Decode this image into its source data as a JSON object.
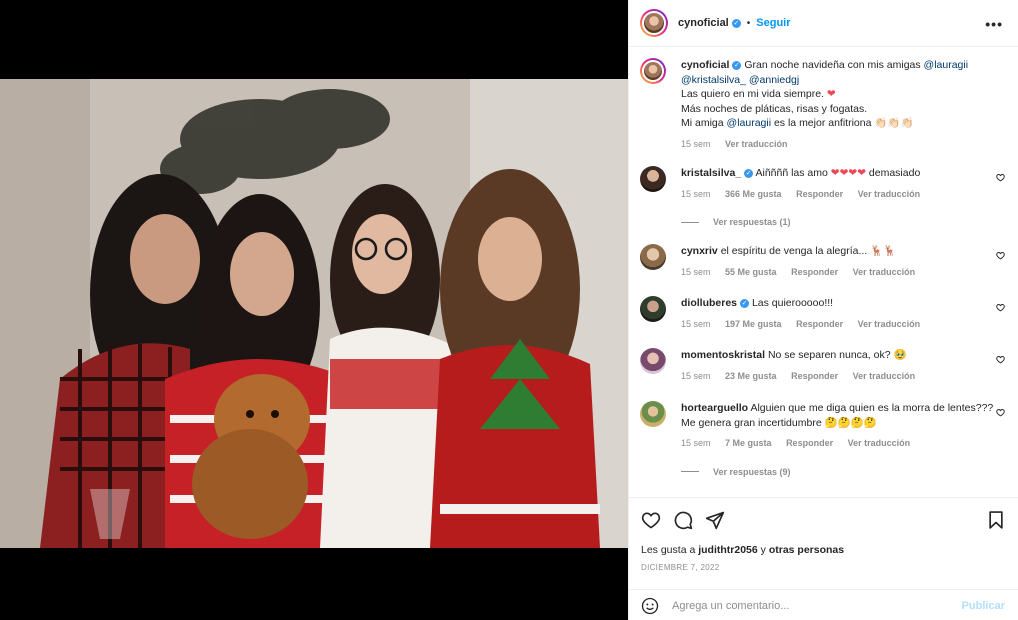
{
  "header": {
    "username": "cynoficial",
    "dot": "•",
    "follow_label": "Seguir",
    "more_label": "•••",
    "more_icon": "more-options-icon"
  },
  "caption": {
    "username": "cynoficial",
    "line1_text": "Gran noche navideña con mis amigas",
    "line1_mention": "@lauragii",
    "line2_mention_a": "@kristalsilva_",
    "line2_mention_b": "@anniedgj",
    "line3": "Las quiero en mi vida siempre.",
    "line3_emoji": "❤",
    "line4": "Más noches de pláticas, risas y fogatas.",
    "line5_prefix": "Mi amiga",
    "line5_mention": "@lauragii",
    "line5_suffix": "es la mejor anfitriona",
    "line5_emoji": "👏🏻👏🏻👏🏻",
    "time": "15 sem",
    "translate": "Ver traducción"
  },
  "comments": [
    {
      "username": "kristalsilva_",
      "verified": true,
      "text": "Aiññññ las amo",
      "emoji": "❤❤❤❤",
      "text_after": "demasiado",
      "time": "15 sem",
      "likes": "366 Me gusta",
      "reply": "Responder",
      "translate": "Ver traducción",
      "replies": "Ver respuestas (1)"
    },
    {
      "username": "cynxriv",
      "verified": false,
      "text": "el espíritu de venga la alegría... 🦌🦌",
      "time": "15 sem",
      "likes": "55 Me gusta",
      "reply": "Responder",
      "translate": "Ver traducción"
    },
    {
      "username": "diolluberes",
      "verified": true,
      "text": "Las quierooooo!!!",
      "time": "15 sem",
      "likes": "197 Me gusta",
      "reply": "Responder",
      "translate": "Ver traducción"
    },
    {
      "username": "momentoskristal",
      "verified": false,
      "text": "No se separen nunca, ok?",
      "emoji": "🥹",
      "time": "15 sem",
      "likes": "23 Me gusta",
      "reply": "Responder",
      "translate": "Ver traducción"
    },
    {
      "username": "hortearguello",
      "verified": false,
      "text": "Alguien que me diga quien es la morra de lentes??? Me genera gran incertidumbre 🤔🤔🤔🤔",
      "time": "15 sem",
      "likes": "7 Me gusta",
      "reply": "Responder",
      "translate": "Ver traducción",
      "replies": "Ver respuestas (9)"
    }
  ],
  "actions": {
    "like_icon": "heart-icon",
    "comment_icon": "comment-icon",
    "share_icon": "share-icon",
    "save_icon": "bookmark-icon",
    "likes_prefix": "Les gusta a",
    "likes_user": "judithtr2056",
    "likes_middle": "y",
    "likes_others": "otras personas",
    "date": "DICIEMBRE 7, 2022"
  },
  "composer": {
    "emoji_icon": "smiley-icon",
    "placeholder": "Agrega un comentario...",
    "publish_label": "Publicar"
  },
  "colors": {
    "accent": "#0095f6",
    "verified": "#3897f0",
    "heart": "#ed4956",
    "publish_disabled": "#b2dffc"
  }
}
